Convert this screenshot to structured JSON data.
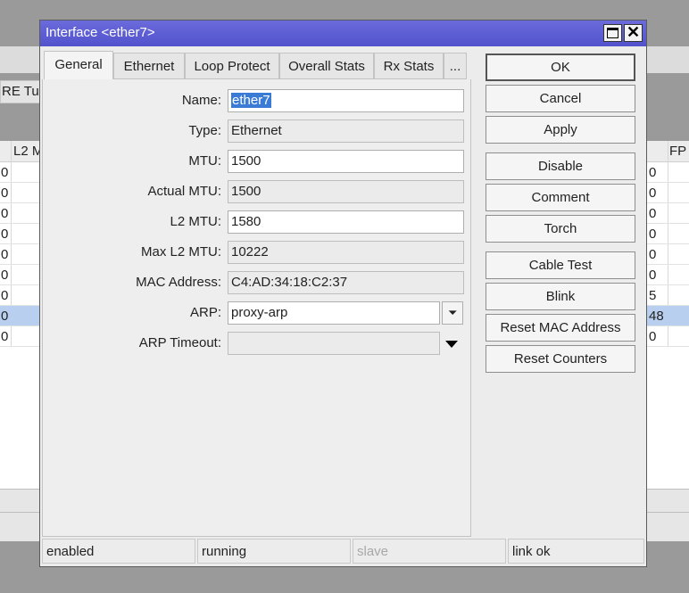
{
  "background": {
    "tab_fragment": "RE Tu",
    "left_column_header": "L2 M",
    "right_column_header": "FP",
    "left_cells": [
      "0",
      "0",
      "0",
      "0",
      "0",
      "0",
      "0",
      "0",
      "0"
    ],
    "right_cells": [
      "0",
      "0",
      "0",
      "0",
      "0",
      "0",
      "5",
      "48",
      "0"
    ],
    "selected_row_index": 7
  },
  "dialog": {
    "title": "Interface <ether7>",
    "tabs": [
      {
        "label": "General"
      },
      {
        "label": "Ethernet"
      },
      {
        "label": "Loop Protect"
      },
      {
        "label": "Overall Stats"
      },
      {
        "label": "Rx Stats"
      },
      {
        "label": "..."
      }
    ],
    "fields": {
      "name": {
        "label": "Name:",
        "value": "ether7"
      },
      "type": {
        "label": "Type:",
        "value": "Ethernet"
      },
      "mtu": {
        "label": "MTU:",
        "value": "1500"
      },
      "actual_mtu": {
        "label": "Actual MTU:",
        "value": "1500"
      },
      "l2_mtu": {
        "label": "L2 MTU:",
        "value": "1580"
      },
      "max_l2_mtu": {
        "label": "Max L2 MTU:",
        "value": "10222"
      },
      "mac_address": {
        "label": "MAC Address:",
        "value": "C4:AD:34:18:C2:37"
      },
      "arp": {
        "label": "ARP:",
        "value": "proxy-arp"
      },
      "arp_timeout": {
        "label": "ARP Timeout:",
        "value": ""
      }
    },
    "buttons": {
      "ok": "OK",
      "cancel": "Cancel",
      "apply": "Apply",
      "disable": "Disable",
      "comment": "Comment",
      "torch": "Torch",
      "cable_test": "Cable Test",
      "blink": "Blink",
      "reset_mac": "Reset MAC Address",
      "reset_counters": "Reset Counters"
    },
    "status": {
      "enabled": "enabled",
      "running": "running",
      "slave": "slave",
      "link": "link ok"
    }
  },
  "colors": {
    "titlebar": "#5a5ad2",
    "selection": "#3a7bd5",
    "selected_row": "#b8cff0"
  }
}
